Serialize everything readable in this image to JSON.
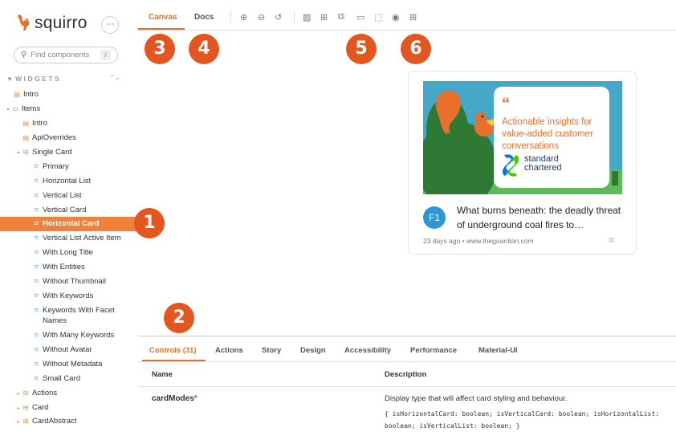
{
  "brand": {
    "name": "squirro",
    "more_label": "···"
  },
  "search": {
    "placeholder": "Find components",
    "shortcut": "/"
  },
  "sidebar": {
    "section_label": "WIDGETS",
    "section_toggle": "⌃⌄",
    "items": [
      {
        "label": "Intro"
      },
      {
        "label": "Items"
      },
      {
        "label": "Intro"
      },
      {
        "label": "ApiOverrides"
      },
      {
        "label": "Single Card"
      },
      {
        "label": "Primary"
      },
      {
        "label": "Horizontal List"
      },
      {
        "label": "Vertical List"
      },
      {
        "label": "Vertical Card"
      },
      {
        "label": "Horizontal Card"
      },
      {
        "label": "Vertical List Active Item"
      },
      {
        "label": "With Long Title"
      },
      {
        "label": "With Entities"
      },
      {
        "label": "Without Thumbnail"
      },
      {
        "label": "With Keywords"
      },
      {
        "label": "Keywords With Facet"
      },
      {
        "label": "Names"
      },
      {
        "label": "With Many Keywords"
      },
      {
        "label": "Without Avatar"
      },
      {
        "label": "Without Metadata"
      },
      {
        "label": "Small Card"
      },
      {
        "label": "Actions"
      },
      {
        "label": "Card"
      },
      {
        "label": "CardAbstract"
      }
    ]
  },
  "toolbar": {
    "tabs": [
      {
        "label": "Canvas"
      },
      {
        "label": "Docs"
      }
    ]
  },
  "card": {
    "quote_mark": "“",
    "quote_text": "Actionable insights for value-added customer conversations",
    "brand_line1": "standard",
    "brand_line2": "chartered",
    "avatar_text": "F1",
    "title": "What burns beneath: the deadly threat of underground coal fires to…",
    "meta": "23 days ago  •  www.theguardian.com"
  },
  "markers": [
    "1",
    "2",
    "3",
    "4",
    "5",
    "6"
  ],
  "addons": {
    "tabs": [
      {
        "label": "Controls (31)"
      },
      {
        "label": "Actions"
      },
      {
        "label": "Story"
      },
      {
        "label": "Design"
      },
      {
        "label": "Accessibility"
      },
      {
        "label": "Performance"
      },
      {
        "label": "Material-UI"
      }
    ],
    "columns": {
      "name": "Name",
      "description": "Description"
    },
    "row": {
      "name": "cardModes",
      "required_mark": "*",
      "description": "Display type that will affect card styling and behaviour.",
      "type": "{ isHorizontalCard: boolean; isVerticalCard: boolean; isHorizontalList: boolean; isVerticalList: boolean; }"
    }
  },
  "colors": {
    "accent": "#e8702a",
    "selected": "#f0813a",
    "marker": "#e4561f",
    "avatar": "#2e95d6"
  }
}
